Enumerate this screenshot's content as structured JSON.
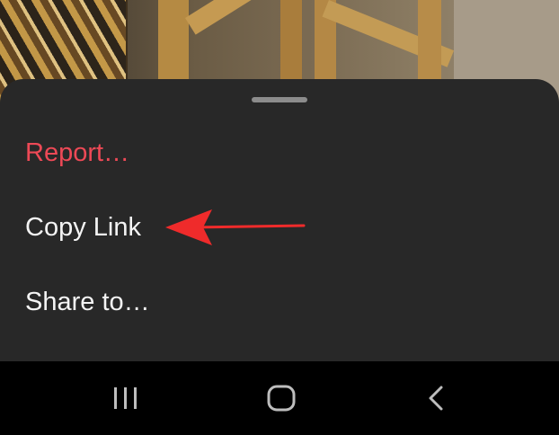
{
  "menu": {
    "items": [
      {
        "label": "Report…",
        "color": "#ed4956"
      },
      {
        "label": "Copy Link",
        "color": "#f4f4f4"
      },
      {
        "label": "Share to…",
        "color": "#f4f4f4"
      }
    ]
  },
  "annotation": {
    "arrow_color": "#ef2b2b",
    "points_to": "Copy Link"
  },
  "navbar": {
    "buttons": [
      "recent-apps-icon",
      "home-icon",
      "back-icon"
    ]
  },
  "colors": {
    "sheet_background": "#282828",
    "navbar_background": "#000000",
    "handle": "#8c8c8c"
  }
}
